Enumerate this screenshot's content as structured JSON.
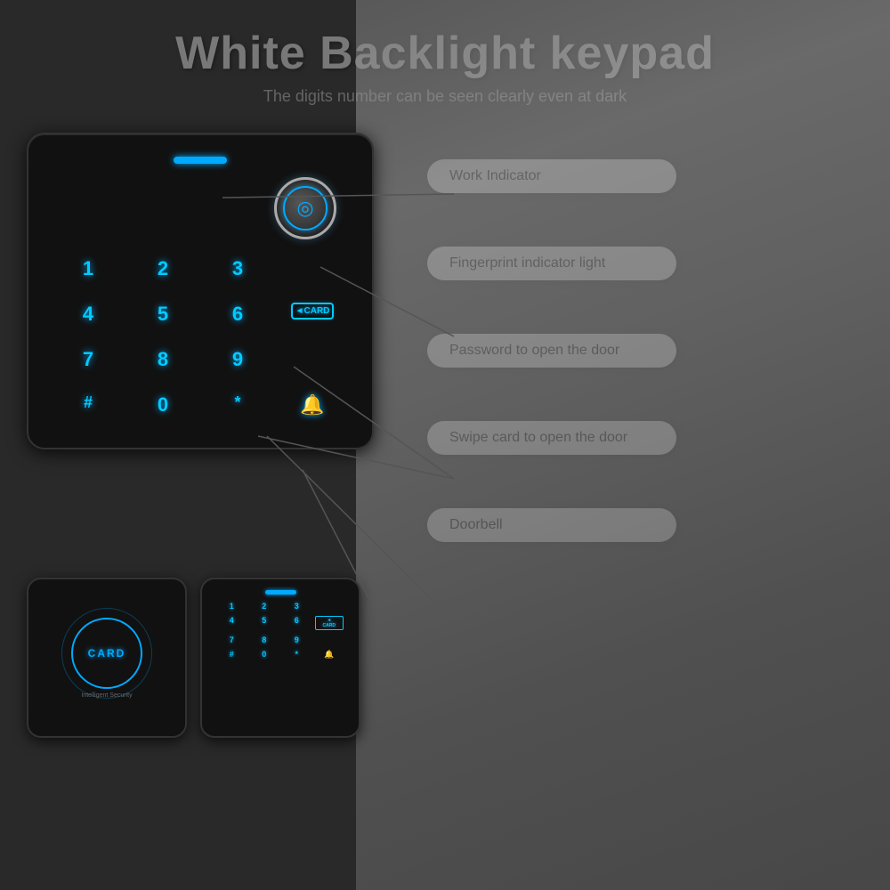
{
  "header": {
    "title": "White Backlight keypad",
    "subtitle": "The digits number can be seen clearly even at dark"
  },
  "keypad": {
    "keys": [
      "1",
      "2",
      "3",
      "",
      "4",
      "5",
      "6",
      "",
      "7",
      "8",
      "9",
      "",
      "#",
      "0",
      "*",
      ""
    ],
    "status_bar_color": "#00aaff",
    "card_label": "◄CARD",
    "bell_label": "🔔"
  },
  "labels": [
    {
      "id": "work-indicator",
      "text": "Work Indicator"
    },
    {
      "id": "fingerprint-indicator",
      "text": "Fingerprint indicator light"
    },
    {
      "id": "password",
      "text": "Password to open the door"
    },
    {
      "id": "swipe-card",
      "text": "Swipe card to open the door"
    },
    {
      "id": "doorbell",
      "text": "Doorbell"
    }
  ],
  "small_devices": {
    "card_reader": {
      "card_text": "CARD",
      "sub_label": "Intelligent Security"
    },
    "keypad": {
      "keys": [
        "1",
        "2",
        "3",
        "4",
        "5",
        "6",
        "7",
        "8",
        "9",
        "#",
        "0",
        "*"
      ]
    }
  }
}
